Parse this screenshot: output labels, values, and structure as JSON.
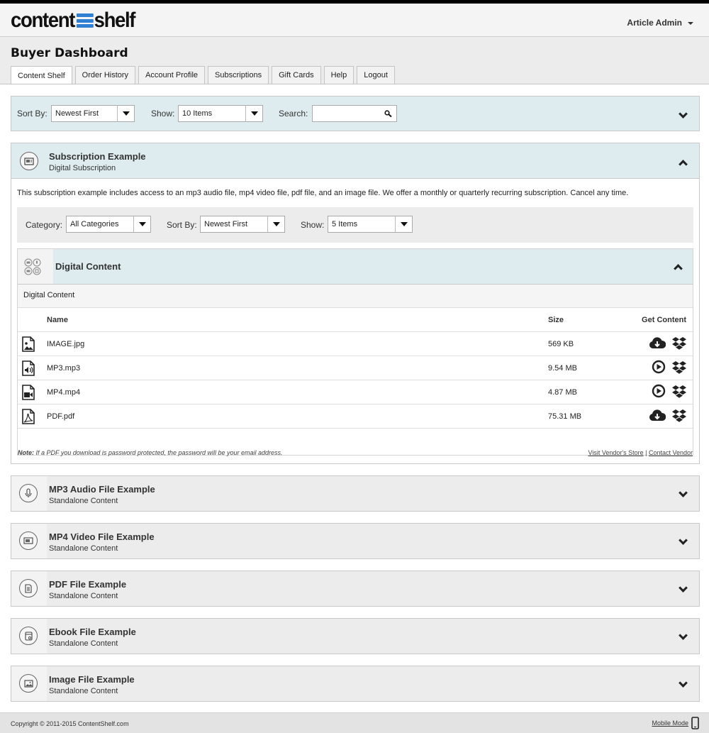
{
  "header": {
    "logo_left": "content",
    "logo_right": "shelf",
    "user_label": "Article Admin"
  },
  "page_title": "Buyer Dashboard",
  "tabs": [
    {
      "label": "Content Shelf",
      "active": true
    },
    {
      "label": "Order History"
    },
    {
      "label": "Account Profile"
    },
    {
      "label": "Subscriptions"
    },
    {
      "label": "Gift Cards"
    },
    {
      "label": "Help"
    },
    {
      "label": "Logout"
    }
  ],
  "filters": {
    "sort_label": "Sort By:",
    "sort_value": "Newest First",
    "show_label": "Show:",
    "show_value": "10 Items",
    "search_label": "Search:",
    "search_value": ""
  },
  "subscription": {
    "title": "Subscription Example",
    "subtitle": "Digital Subscription",
    "description": "This subscription example includes access to an mp3 audio file, mp4 video file, pdf file, and an image file. We offer a monthly or quarterly recurring subscription. Cancel any time.",
    "category_label": "Category:",
    "category_value": "All Categories",
    "sort_label": "Sort By:",
    "sort_value": "Newest First",
    "show_label": "Show:",
    "show_value": "5 Items",
    "digital_content": {
      "title": "Digital Content",
      "subheader": "Digital Content",
      "col_name": "Name",
      "col_size": "Size",
      "col_get": "Get Content",
      "files": [
        {
          "name": "IMAGE.jpg",
          "size": "569 KB",
          "type": "image-file-icon",
          "action": "download"
        },
        {
          "name": "MP3.mp3",
          "size": "9.54 MB",
          "type": "audio-file-icon",
          "action": "play"
        },
        {
          "name": "MP4.mp4",
          "size": "4.87 MB",
          "type": "video-file-icon",
          "action": "play"
        },
        {
          "name": "PDF.pdf",
          "size": "75.31 MB",
          "type": "pdf-file-icon",
          "action": "download"
        }
      ]
    },
    "note_label": "Note:",
    "note_text": " If a PDF you download is password protected, the password will be your email address.",
    "vendor_store": "Visit Vendor's Store",
    "vendor_sep": " | ",
    "contact_vendor": "Contact Vendor"
  },
  "collapsed_items": [
    {
      "title": "MP3 Audio File Example",
      "subtitle": "Standalone Content",
      "icon": "microphone-icon"
    },
    {
      "title": "MP4 Video File Example",
      "subtitle": "Standalone Content",
      "icon": "video-icon"
    },
    {
      "title": "PDF File Example",
      "subtitle": "Standalone Content",
      "icon": "document-icon"
    },
    {
      "title": "Ebook File Example",
      "subtitle": "Standalone Content",
      "icon": "ebook-icon"
    },
    {
      "title": "Image File Example",
      "subtitle": "Standalone Content",
      "icon": "image-icon"
    }
  ],
  "footer": {
    "copyright": "Copyright © 2011-2015 ContentShelf.com",
    "mobile_mode": "Mobile Mode"
  },
  "colors": {
    "accent_blue": "#2f7fd3",
    "header_panel_bg": "#deecef"
  }
}
